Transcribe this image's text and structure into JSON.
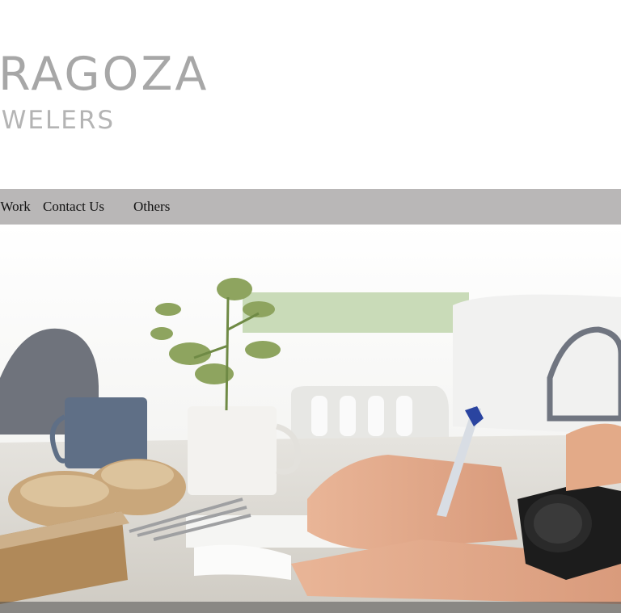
{
  "brand": {
    "logo_line1": "ZARAGOZA",
    "logo_line2": "JEWELERS"
  },
  "nav": {
    "items": [
      {
        "label": "Our Work"
      },
      {
        "label": "Contact Us"
      },
      {
        "label": "Others"
      }
    ]
  },
  "hero": {
    "image_subject": "person-writing-at-table-photo"
  },
  "colors": {
    "nav_background": "#b9b7b7",
    "logo_text": "#a7a7a7",
    "page_background": "#ffffff"
  }
}
